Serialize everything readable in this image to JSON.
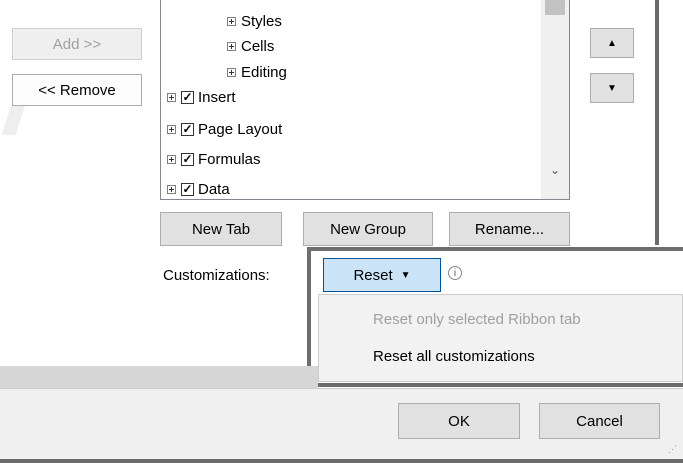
{
  "left_buttons": {
    "add": "Add >>",
    "remove": "<< Remove"
  },
  "tree": {
    "groups": [
      {
        "label": "Styles"
      },
      {
        "label": "Cells"
      },
      {
        "label": "Editing"
      }
    ],
    "tabs": [
      {
        "label": "Insert",
        "checked": true
      },
      {
        "label": "Page Layout",
        "checked": true
      },
      {
        "label": "Formulas",
        "checked": true
      },
      {
        "label": "Data",
        "checked": true
      }
    ]
  },
  "action_buttons": {
    "new_tab": "New Tab",
    "new_group": "New Group",
    "rename": "Rename..."
  },
  "customizations": {
    "label": "Customizations:",
    "reset_label": "Reset",
    "menu": [
      {
        "label": "Reset only selected Ribbon tab",
        "enabled": false
      },
      {
        "label": "Reset all customizations",
        "enabled": true
      }
    ]
  },
  "footer": {
    "ok": "OK",
    "cancel": "Cancel"
  },
  "icons": {
    "move_up": "triangle-up-icon",
    "move_down": "triangle-down-icon",
    "scroll_down": "chevron-down-icon",
    "info": "info-icon",
    "dropdown": "caret-down-icon"
  }
}
